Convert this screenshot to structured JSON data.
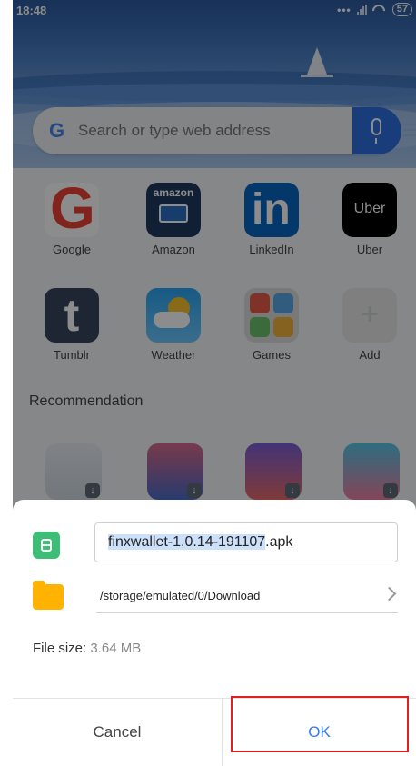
{
  "status_bar": {
    "time": "18:48",
    "battery": "57"
  },
  "search": {
    "placeholder": "Search or type web address"
  },
  "shortcuts": [
    {
      "label": "Google"
    },
    {
      "label": "Amazon"
    },
    {
      "label": "LinkedIn"
    },
    {
      "label": "Uber"
    },
    {
      "label": "Tumblr"
    },
    {
      "label": "Weather"
    },
    {
      "label": "Games"
    },
    {
      "label": "Add"
    }
  ],
  "icon_text": {
    "amazon": "amazon",
    "uber": "Uber"
  },
  "recommendation": {
    "title": "Recommendation"
  },
  "dialog": {
    "filename_selected": "finxwallet-1.0.14-191107",
    "filename_ext": ".apk",
    "path": "/storage/emulated/0/Download",
    "filesize_label": "File size:",
    "filesize_value": "3.64 MB",
    "cancel_label": "Cancel",
    "ok_label": "OK"
  },
  "colors": {
    "ok_text": "#2f7df0",
    "highlight_border": "#e02020",
    "mic_button": "#2f6fe0"
  }
}
